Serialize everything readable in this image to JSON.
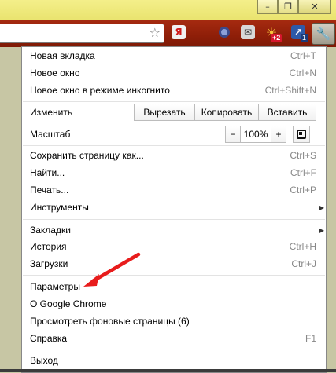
{
  "window": {
    "minimize_glyph": "–",
    "restore_glyph": "❐",
    "close_glyph": "✕"
  },
  "toolbar": {
    "star_glyph": "☆",
    "yandex_glyph": "Я",
    "weather_badge": "+2",
    "pin_badge": "1",
    "wrench_glyph": "🔧"
  },
  "menu": {
    "new_tab": {
      "label": "Новая вкладка",
      "shortcut": "Ctrl+T"
    },
    "new_window": {
      "label": "Новое окно",
      "shortcut": "Ctrl+N"
    },
    "incognito": {
      "label": "Новое окно в режиме инкогнито",
      "shortcut": "Ctrl+Shift+N"
    },
    "edit": {
      "label": "Изменить",
      "cut": "Вырезать",
      "copy": "Копировать",
      "paste": "Вставить"
    },
    "zoom": {
      "label": "Масштаб",
      "minus": "−",
      "value": "100%",
      "plus": "+"
    },
    "save_page": {
      "label": "Сохранить страницу как...",
      "shortcut": "Ctrl+S"
    },
    "find": {
      "label": "Найти...",
      "shortcut": "Ctrl+F"
    },
    "print": {
      "label": "Печать...",
      "shortcut": "Ctrl+P"
    },
    "tools": {
      "label": "Инструменты",
      "arrow": "▶"
    },
    "bookmarks": {
      "label": "Закладки",
      "arrow": "▶"
    },
    "history": {
      "label": "История",
      "shortcut": "Ctrl+H"
    },
    "downloads": {
      "label": "Загрузки",
      "shortcut": "Ctrl+J"
    },
    "settings": {
      "label": "Параметры"
    },
    "about": {
      "label": "О Google Chrome"
    },
    "background_pages": {
      "label": "Просмотреть фоновые страницы (6)"
    },
    "help": {
      "label": "Справка",
      "shortcut": "F1"
    },
    "exit": {
      "label": "Выход"
    }
  },
  "colors": {
    "toolbar": "#8e1e08",
    "frame": "#e9e36e",
    "annotation_arrow": "#e81c1c"
  }
}
